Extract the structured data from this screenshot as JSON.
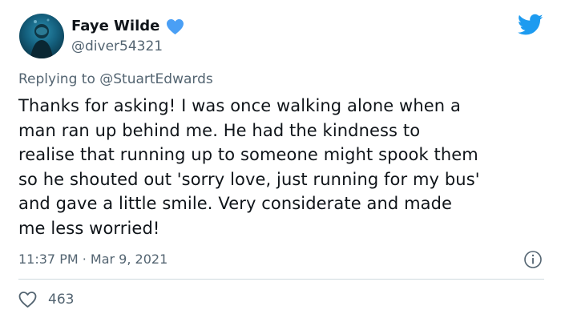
{
  "author": {
    "display_name": "Faye Wilde",
    "handle": "@diver54321",
    "verified_icon": "heart-icon",
    "avatar_icon": "diver-avatar"
  },
  "reply": {
    "prefix": "Replying to ",
    "mention": "@StuartEdwards"
  },
  "tweet": {
    "lines": [
      "Thanks for asking! I was once walking alone when a",
      "man ran up behind me. He had the kindness to",
      "realise that running up to someone might spook them",
      "so he shouted out 'sorry love, just running for my bus'",
      "and gave a little smile. Very considerate and made",
      "me less worried!"
    ]
  },
  "meta": {
    "timestamp": "11:37 PM · Mar 9, 2021"
  },
  "actions": {
    "like_count": "463",
    "like_icon": "heart-outline-icon",
    "info_icon": "info-icon",
    "brand_icon": "twitter-bird-icon"
  },
  "colors": {
    "brand": "#1d9bf0",
    "heart": "#4a9ff5",
    "secondary_text": "#536471",
    "divider": "#cfd9de"
  }
}
